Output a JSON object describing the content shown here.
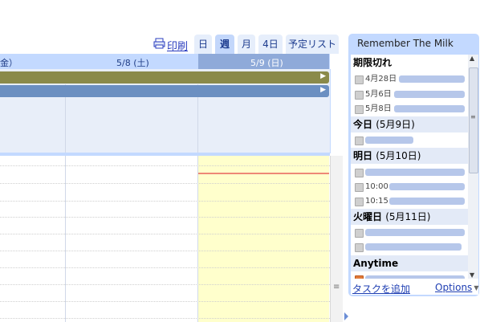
{
  "toolbar": {
    "print_label": "印刷",
    "view_tabs": [
      "日",
      "週",
      "月",
      "4日",
      "予定リスト"
    ],
    "active_tab": "週"
  },
  "calendar": {
    "column_headers": [
      "金）",
      "5/8 (土)",
      "5/9 (日)"
    ],
    "allday_bar_colors": [
      "#8a8a4a",
      "#6b8fc1"
    ]
  },
  "rtm": {
    "title": "Remember The Milk",
    "sections": {
      "overdue": "期限切れ",
      "today": "今日",
      "today_date": "(5月9日)",
      "tomorrow": "明日",
      "tomorrow_date": "(5月10日)",
      "tuesday": "火曜日",
      "tuesday_date": "(5月11日)",
      "anytime": "Anytime"
    },
    "overdue_tasks": [
      "4月28日",
      "5月6日",
      "5月8日"
    ],
    "tomorrow_tasks": [
      "",
      "10:00",
      "10:15"
    ],
    "footer": {
      "add_task": "タスクを追加",
      "options": "Options"
    }
  }
}
